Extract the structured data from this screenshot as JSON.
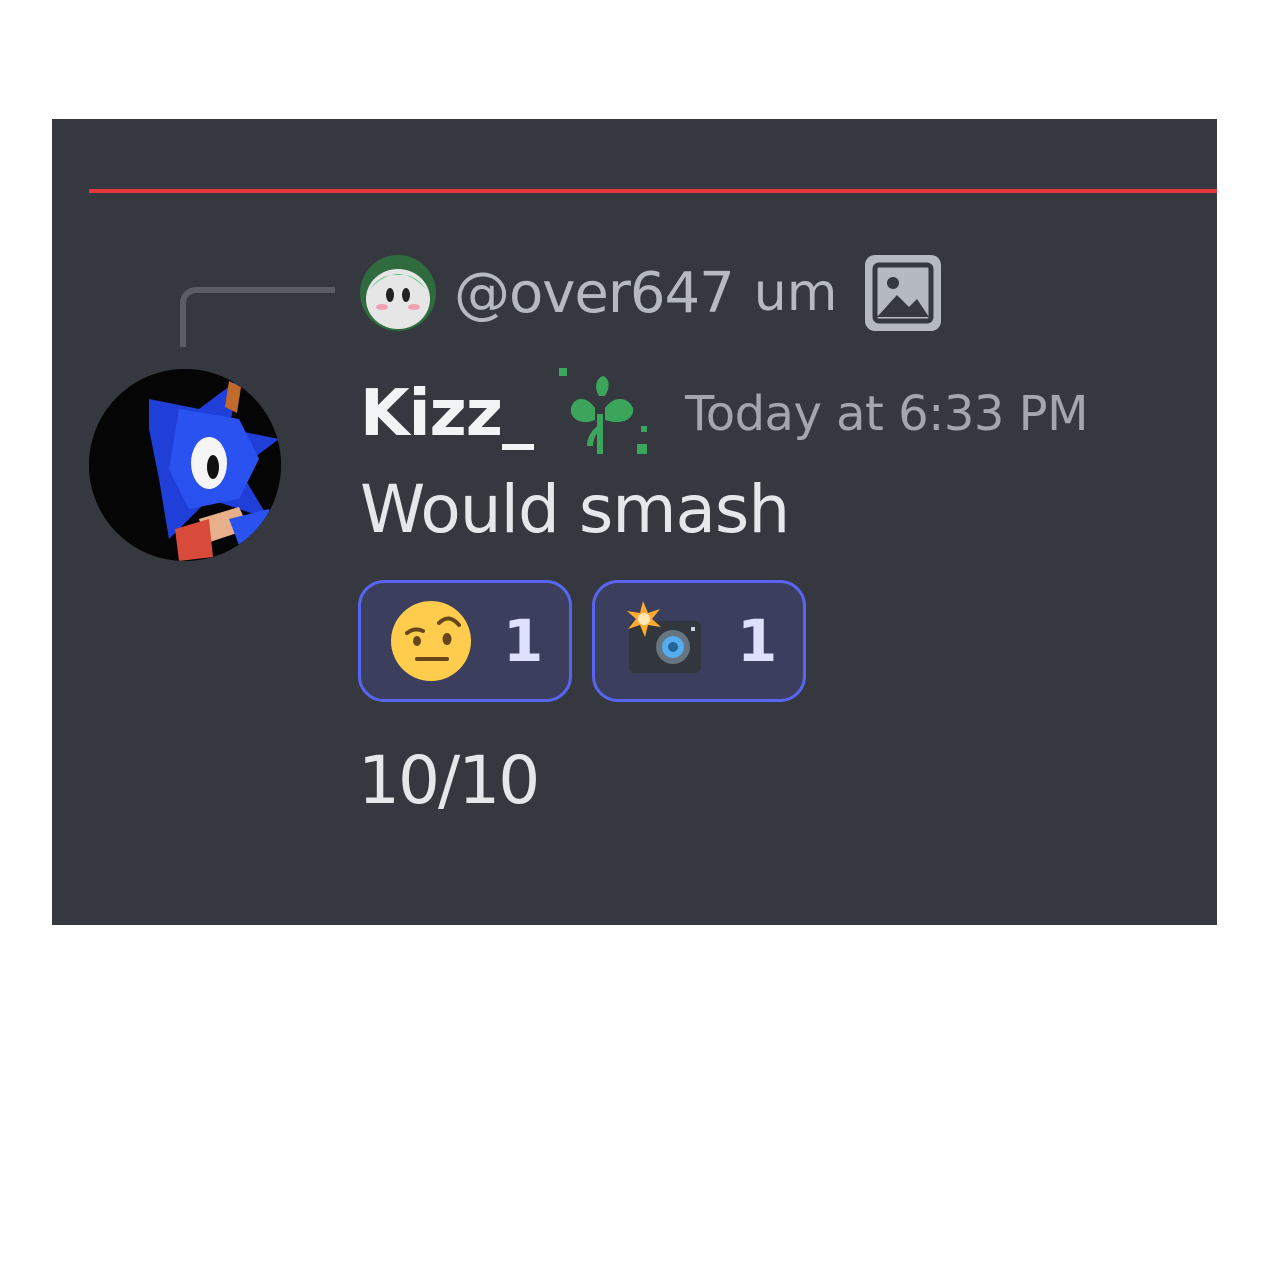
{
  "reply": {
    "author": "@over647",
    "text": "um",
    "attachment_icon": "image-icon",
    "avatar_icon": "kirby-avatar"
  },
  "message": {
    "username": "Kizz_",
    "badge_icon": "sprout-badge-icon",
    "timestamp": "Today at 6:33 PM",
    "content": "Would smash",
    "avatar_icon": "sonic-avatar",
    "reactions": [
      {
        "emoji": "face-with-raised-eyebrow-emoji",
        "count": "1"
      },
      {
        "emoji": "camera-with-flash-emoji",
        "count": "1"
      }
    ]
  },
  "followup": {
    "content": "10/10"
  },
  "colors": {
    "background": "#36383f",
    "new_messages_divider": "#e5383d",
    "reaction_border": "#5865f2",
    "reaction_background": "#3b3e5c",
    "badge_green": "#3ba55c"
  }
}
